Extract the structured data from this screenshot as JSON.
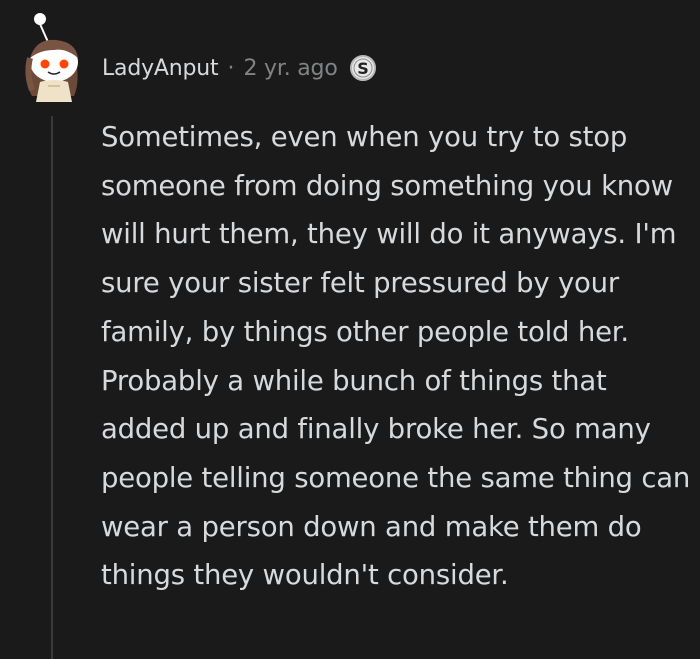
{
  "comment": {
    "username": "LadyAnput",
    "separator": "·",
    "time_ago": "2 yr. ago",
    "badge_icon": "s-award-icon",
    "avatar_icon": "snoo-avatar-icon",
    "text": "Sometimes, even when you try to stop someone from doing something you know will hurt them, they will do it anyways. I'm sure your sister felt pressured by your family, by things other people told her. Probably a while bunch of things that added up and finally broke her. So many people telling someone the same thing can wear a person down and make them do things they wouldn't consider."
  },
  "colors": {
    "background": "#1a1a1b",
    "text": "#d7dadc",
    "meta": "#818384",
    "thread_line": "#3a3a3c",
    "avatar_accent": "#ff4500"
  }
}
